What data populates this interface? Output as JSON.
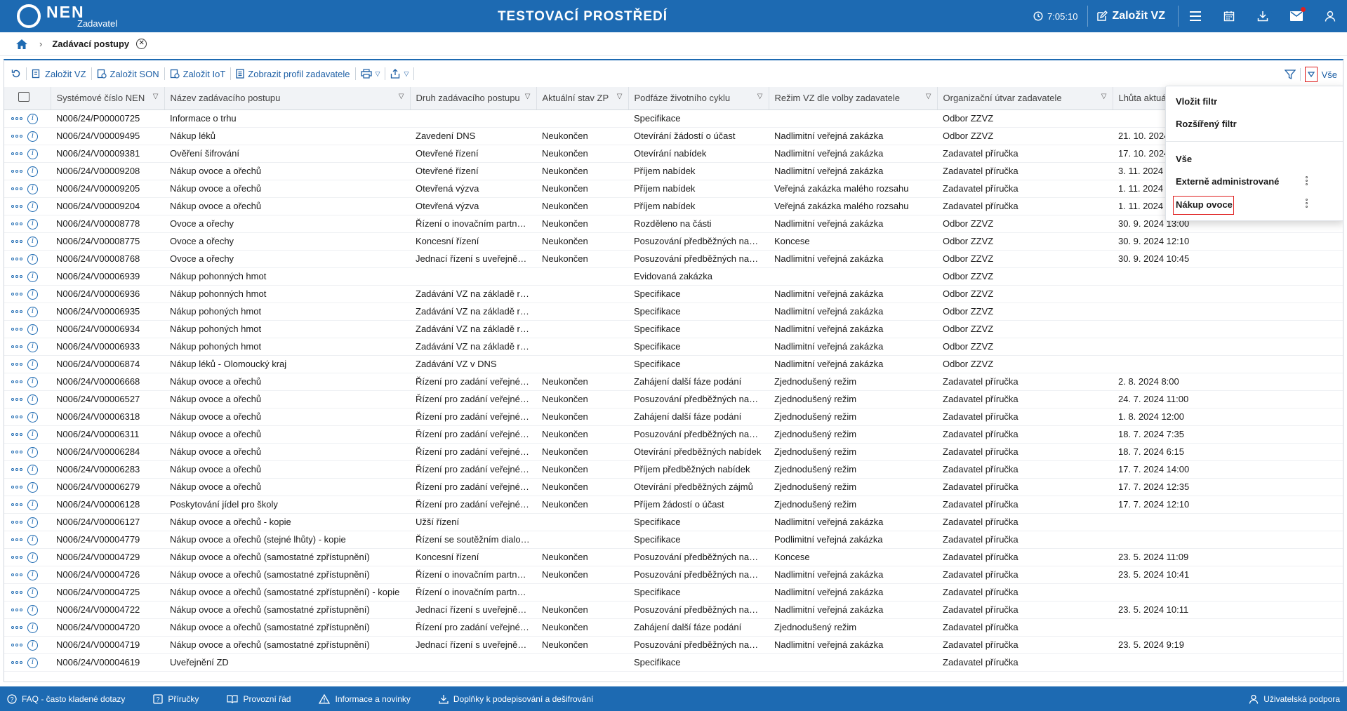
{
  "header": {
    "logo": "NEN",
    "logo_sub": "Zadavatel",
    "title": "TESTOVACÍ PROSTŘEDÍ",
    "timer": "7:05:10",
    "create_vz": "Založit VZ"
  },
  "breadcrumb": {
    "title": "Zadávací postupy"
  },
  "toolbar": {
    "buttons": [
      "Založit VZ",
      "Založit SON",
      "Založit IoT",
      "Zobrazit profil zadavatele"
    ],
    "filter_label": "Vše"
  },
  "table": {
    "columns": [
      "Systémové číslo NEN",
      "Název zadávacího postupu",
      "Druh zadávacího postupu",
      "Aktuální stav ZP",
      "Podfáze životního cyklu",
      "Režim VZ dle volby zadavatele",
      "Organizační útvar zadavatele",
      "Lhůta aktuál"
    ],
    "rows": [
      [
        "N006/24/P00000725",
        "Informace o trhu",
        "",
        "",
        "Specifikace",
        "",
        "Odbor ZZVZ",
        ""
      ],
      [
        "N006/24/V00009495",
        "Nákup léků",
        "Zavedení DNS",
        "Neukončen",
        "Otevírání žádostí o účast",
        "Nadlimitní veřejná zakázka",
        "Odbor ZZVZ",
        "21. 10. 2024"
      ],
      [
        "N006/24/V00009381",
        "Ověření šifrování",
        "Otevřené řízení",
        "Neukončen",
        "Otevírání nabídek",
        "Nadlimitní veřejná zakázka",
        "Zadavatel příručka",
        "17. 10. 2024"
      ],
      [
        "N006/24/V00009208",
        "Nákup ovoce a ořechů",
        "Otevřené řízení",
        "Neukončen",
        "Příjem nabídek",
        "Nadlimitní veřejná zakázka",
        "Zadavatel příručka",
        "3. 11. 2024"
      ],
      [
        "N006/24/V00009205",
        "Nákup ovoce a ořechů",
        "Otevřená výzva",
        "Neukončen",
        "Příjem nabídek",
        "Veřejná zakázka malého rozsahu",
        "Zadavatel příručka",
        "1. 11. 2024"
      ],
      [
        "N006/24/V00009204",
        "Nákup ovoce a ořechů",
        "Otevřená výzva",
        "Neukončen",
        "Příjem nabídek",
        "Veřejná zakázka malého rozsahu",
        "Zadavatel příručka",
        "1. 11. 2024"
      ],
      [
        "N006/24/V00008778",
        "Ovoce a ořechy",
        "Řízení o inovačním partnerství",
        "Neukončen",
        "Rozděleno na části",
        "Nadlimitní veřejná zakázka",
        "Odbor ZZVZ",
        "30. 9. 2024 13:00"
      ],
      [
        "N006/24/V00008775",
        "Ovoce a ořechy",
        "Koncesní řízení",
        "Neukončen",
        "Posuzování předběžných nabídek",
        "Koncese",
        "Odbor ZZVZ",
        "30. 9. 2024 12:10"
      ],
      [
        "N006/24/V00008768",
        "Ovoce a ořechy",
        "Jednací řízení s uveřejněním",
        "Neukončen",
        "Posuzování předběžných nabídek",
        "Nadlimitní veřejná zakázka",
        "Odbor ZZVZ",
        "30. 9. 2024 10:45"
      ],
      [
        "N006/24/V00006939",
        "Nákup pohonných hmot",
        "",
        "",
        "Evidovaná zakázka",
        "",
        "Odbor ZZVZ",
        ""
      ],
      [
        "N006/24/V00006936",
        "Nákup pohonných hmot",
        "Zadávání VZ na základě rámcové dohody",
        "",
        "Specifikace",
        "Nadlimitní veřejná zakázka",
        "Odbor ZZVZ",
        ""
      ],
      [
        "N006/24/V00006935",
        "Nákup pohoných hmot",
        "Zadávání VZ na základě rámcové dohody",
        "",
        "Specifikace",
        "Nadlimitní veřejná zakázka",
        "Odbor ZZVZ",
        ""
      ],
      [
        "N006/24/V00006934",
        "Nákup pohoných hmot",
        "Zadávání VZ na základě rámcové dohody",
        "",
        "Specifikace",
        "Nadlimitní veřejná zakázka",
        "Odbor ZZVZ",
        ""
      ],
      [
        "N006/24/V00006933",
        "Nákup pohoných hmot",
        "Zadávání VZ na základě rámcové dohody",
        "",
        "Specifikace",
        "Nadlimitní veřejná zakázka",
        "Odbor ZZVZ",
        ""
      ],
      [
        "N006/24/V00006874",
        "Nákup léků - Olomoucký kraj",
        "Zadávání VZ v DNS",
        "",
        "Specifikace",
        "Nadlimitní veřejná zakázka",
        "Odbor ZZVZ",
        ""
      ],
      [
        "N006/24/V00006668",
        "Nákup ovoce a ořechů",
        "Řízení pro zadání veřejné zakázky",
        "Neukončen",
        "Zahájení další fáze podání",
        "Zjednodušený režim",
        "Zadavatel příručka",
        "2. 8. 2024 8:00"
      ],
      [
        "N006/24/V00006527",
        "Nákup ovoce a ořechů",
        "Řízení pro zadání veřejné zakázky",
        "Neukončen",
        "Posuzování předběžných nabídek",
        "Zjednodušený režim",
        "Zadavatel příručka",
        "24. 7. 2024 11:00"
      ],
      [
        "N006/24/V00006318",
        "Nákup ovoce a ořechů",
        "Řízení pro zadání veřejné zakázky",
        "Neukončen",
        "Zahájení další fáze podání",
        "Zjednodušený režim",
        "Zadavatel příručka",
        "1. 8. 2024 12:00"
      ],
      [
        "N006/24/V00006311",
        "Nákup ovoce a ořechů",
        "Řízení pro zadání veřejné zakázky",
        "Neukončen",
        "Posuzování předběžných nabídek",
        "Zjednodušený režim",
        "Zadavatel příručka",
        "18. 7. 2024 7:35"
      ],
      [
        "N006/24/V00006284",
        "Nákup ovoce a ořechů",
        "Řízení pro zadání veřejné zakázky",
        "Neukončen",
        "Otevírání předběžných nabídek",
        "Zjednodušený režim",
        "Zadavatel příručka",
        "18. 7. 2024 6:15"
      ],
      [
        "N006/24/V00006283",
        "Nákup ovoce a ořechů",
        "Řízení pro zadání veřejné zakázky",
        "Neukončen",
        "Příjem předběžných nabídek",
        "Zjednodušený režim",
        "Zadavatel příručka",
        "17. 7. 2024 14:00"
      ],
      [
        "N006/24/V00006279",
        "Nákup ovoce a ořechů",
        "Řízení pro zadání veřejné zakázky",
        "Neukončen",
        "Otevírání předběžných zájmů",
        "Zjednodušený režim",
        "Zadavatel příručka",
        "17. 7. 2024 12:35"
      ],
      [
        "N006/24/V00006128",
        "Poskytování jídel pro školy",
        "Řízení pro zadání veřejné zakázky",
        "Neukončen",
        "Příjem žádostí o účast",
        "Zjednodušený režim",
        "Zadavatel příručka",
        "17. 7. 2024 12:10"
      ],
      [
        "N006/24/V00006127",
        "Nákup ovoce a ořechů - kopie",
        "Užší řízení",
        "",
        "Specifikace",
        "Nadlimitní veřejná zakázka",
        "Zadavatel příručka",
        ""
      ],
      [
        "N006/24/V00004779",
        "Nákup ovoce a ořechů (stejné lhůty) - kopie",
        "Řízení se soutěžním dialogem",
        "",
        "Specifikace",
        "Podlimitní veřejná zakázka",
        "Zadavatel příručka",
        ""
      ],
      [
        "N006/24/V00004729",
        "Nákup ovoce a ořechů (samostatné zpřístupnění)",
        "Koncesní řízení",
        "Neukončen",
        "Posuzování předběžných nabídek",
        "Koncese",
        "Zadavatel příručka",
        "23. 5. 2024 11:09"
      ],
      [
        "N006/24/V00004726",
        "Nákup ovoce a ořechů (samostatné zpřístupnění)",
        "Řízení o inovačním partnerství",
        "Neukončen",
        "Posuzování předběžných nabídek",
        "Nadlimitní veřejná zakázka",
        "Zadavatel příručka",
        "23. 5. 2024 10:41"
      ],
      [
        "N006/24/V00004725",
        "Nákup ovoce a ořechů (samostatné zpřístupnění) - kopie",
        "Řízení o inovačním partnerství",
        "",
        "Specifikace",
        "Nadlimitní veřejná zakázka",
        "Zadavatel příručka",
        ""
      ],
      [
        "N006/24/V00004722",
        "Nákup ovoce a ořechů (samostatné zpřístupnění)",
        "Jednací řízení s uveřejněním",
        "Neukončen",
        "Posuzování předběžných nabídek",
        "Nadlimitní veřejná zakázka",
        "Zadavatel příručka",
        "23. 5. 2024 10:11"
      ],
      [
        "N006/24/V00004720",
        "Nákup ovoce a ořechů (samostatné zpřístupnění)",
        "Řízení pro zadání veřejné zakázky",
        "Neukončen",
        "Zahájení další fáze podání",
        "Zjednodušený režim",
        "Zadavatel příručka",
        ""
      ],
      [
        "N006/24/V00004719",
        "Nákup ovoce a ořechů (samostatné zpřístupnění)",
        "Jednací řízení s uveřejněním",
        "Neukončen",
        "Posuzování předběžných nabídek",
        "Nadlimitní veřejná zakázka",
        "Zadavatel příručka",
        "23. 5. 2024 9:19"
      ],
      [
        "N006/24/V00004619",
        "Uveřejnění ZD",
        "",
        "",
        "Specifikace",
        "",
        "Zadavatel příručka",
        ""
      ]
    ]
  },
  "dropdown": {
    "items": [
      "Vložit filtr",
      "Rozšířený filtr",
      "Vše",
      "Externě administrované",
      "Nákup ovoce"
    ]
  },
  "footer": {
    "items": [
      "FAQ - často kladené dotazy",
      "Příručky",
      "Provozní řád",
      "Informace a novinky",
      "Doplňky k podepisování a dešifrování"
    ],
    "support": "Uživatelská podpora"
  },
  "colors": {
    "primary": "#1d6ab2",
    "highlight": "#e02020"
  }
}
